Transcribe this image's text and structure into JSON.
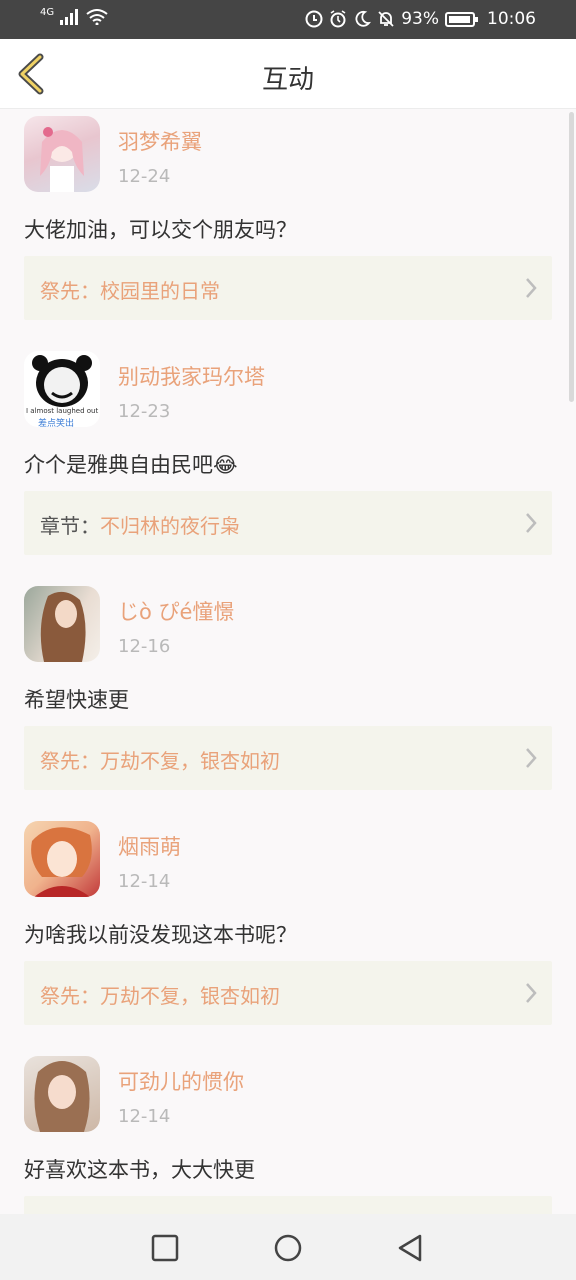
{
  "status": {
    "network": "4G",
    "battery_pct": "93%",
    "time": "10:06",
    "icons": [
      "signal-icon",
      "wifi-icon",
      "data-saver-icon",
      "alarm-icon",
      "moon-icon",
      "mute-icon",
      "battery-icon"
    ]
  },
  "header": {
    "title": "互动",
    "back_icon": "chevron-left-icon"
  },
  "items": [
    {
      "name": "羽梦希翼",
      "date": "12-24",
      "comment": "大佬加油，可以交个朋友吗？",
      "ref_label": "祭先：",
      "ref_title": "校园里的日常",
      "ref_label_color": "#e9a27a"
    },
    {
      "name": "别动我家玛尔塔",
      "date": "12-23",
      "comment": "介个是雅典自由民吧😂",
      "ref_label": "章节：",
      "ref_title": "不归林的夜行枭",
      "ref_label_color": "#555555",
      "avatar_text_1": "I almost laughed out loud",
      "avatar_text_2": "差点笑出"
    },
    {
      "name": "じò ぴé憧憬",
      "date": "12-16",
      "comment": "希望快速更",
      "ref_label": "祭先：",
      "ref_title": "万劫不复，银杏如初",
      "ref_label_color": "#e9a27a"
    },
    {
      "name": "烟雨萌",
      "date": "12-14",
      "comment": "为啥我以前没发现这本书呢？",
      "ref_label": "祭先：",
      "ref_title": "万劫不复，银杏如初",
      "ref_label_color": "#e9a27a"
    },
    {
      "name": "可劲儿的惯你",
      "date": "12-14",
      "comment": "好喜欢这本书，大大快更",
      "ref_label": "",
      "ref_title": "",
      "ref_label_color": "#e9a27a"
    }
  ],
  "navbar": {
    "buttons": [
      "recent-apps-icon",
      "home-icon",
      "back-triangle-icon"
    ]
  },
  "colors": {
    "accent": "#e9a27a",
    "ref_bg": "#f4f4ec",
    "status_bg": "#454545"
  }
}
